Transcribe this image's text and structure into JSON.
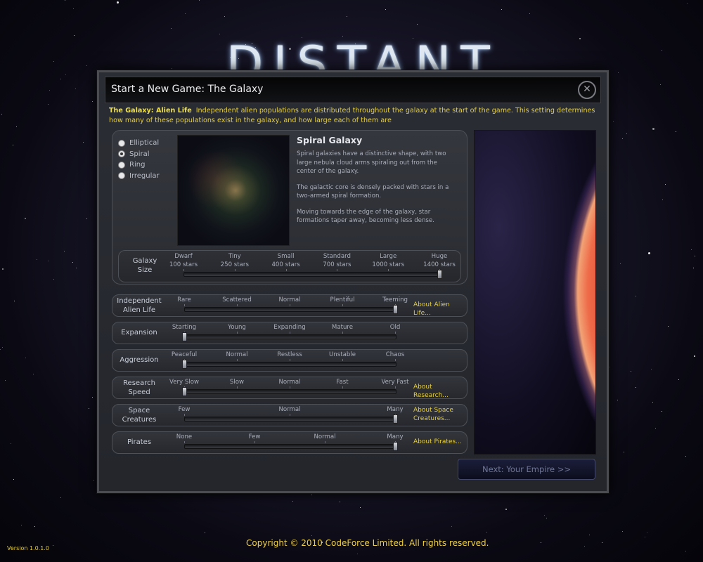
{
  "logo_text": "DISTANT",
  "dialog": {
    "title": "Start a New Game: The Galaxy",
    "close_glyph": "✕"
  },
  "help": {
    "label": "The Galaxy: Alien Life",
    "text": "Independent alien populations are distributed throughout the galaxy at the start of the game. This setting determines how many of these populations exist in the galaxy, and how large each of them are"
  },
  "shapes": {
    "options": [
      "Elliptical",
      "Spiral",
      "Ring",
      "Irregular"
    ],
    "selected_index": 1,
    "name": "Spiral Galaxy",
    "description": [
      "Spiral galaxies have a distinctive shape, with two large nebula cloud arms spiraling out from the center of the galaxy.",
      "The galactic core is densely packed with stars in a two-armed spiral formation.",
      "Moving towards the edge of the galaxy, star formations taper away, becoming less dense."
    ]
  },
  "galaxy_size": {
    "label": "Galaxy Size",
    "ticks": [
      {
        "name": "Dwarf",
        "stars": "100 stars"
      },
      {
        "name": "Tiny",
        "stars": "250 stars"
      },
      {
        "name": "Small",
        "stars": "400 stars"
      },
      {
        "name": "Standard",
        "stars": "700 stars"
      },
      {
        "name": "Large",
        "stars": "1000 stars"
      },
      {
        "name": "Huge",
        "stars": "1400 stars"
      }
    ],
    "value_index": 5
  },
  "settings": [
    {
      "label": "Independent Alien Life",
      "ticks": [
        "Rare",
        "Scattered",
        "Normal",
        "Plentiful",
        "Teeming"
      ],
      "value_index": 4,
      "link": "About Alien Life..."
    },
    {
      "label": "Expansion",
      "ticks": [
        "Starting",
        "Young",
        "Expanding",
        "Mature",
        "Old"
      ],
      "value_index": 0,
      "link": ""
    },
    {
      "label": "Aggression",
      "ticks": [
        "Peaceful",
        "Normal",
        "Restless",
        "Unstable",
        "Chaos"
      ],
      "value_index": 0,
      "link": ""
    },
    {
      "label": "Research Speed",
      "ticks": [
        "Very Slow",
        "Slow",
        "Normal",
        "Fast",
        "Very Fast"
      ],
      "value_index": 0,
      "link": "About Research..."
    },
    {
      "label": "Space Creatures",
      "ticks": [
        "Few",
        "Normal",
        "Many"
      ],
      "value_index": 2,
      "link": "About Space Creatures..."
    },
    {
      "label": "Pirates",
      "ticks": [
        "None",
        "Few",
        "Normal",
        "Many"
      ],
      "value_index": 3,
      "link": "About Pirates..."
    }
  ],
  "next_button": "Next: Your Empire >>",
  "version": "Version 1.0.1.0",
  "copyright": "Copyright © 2010 CodeForce Limited. All rights reserved."
}
